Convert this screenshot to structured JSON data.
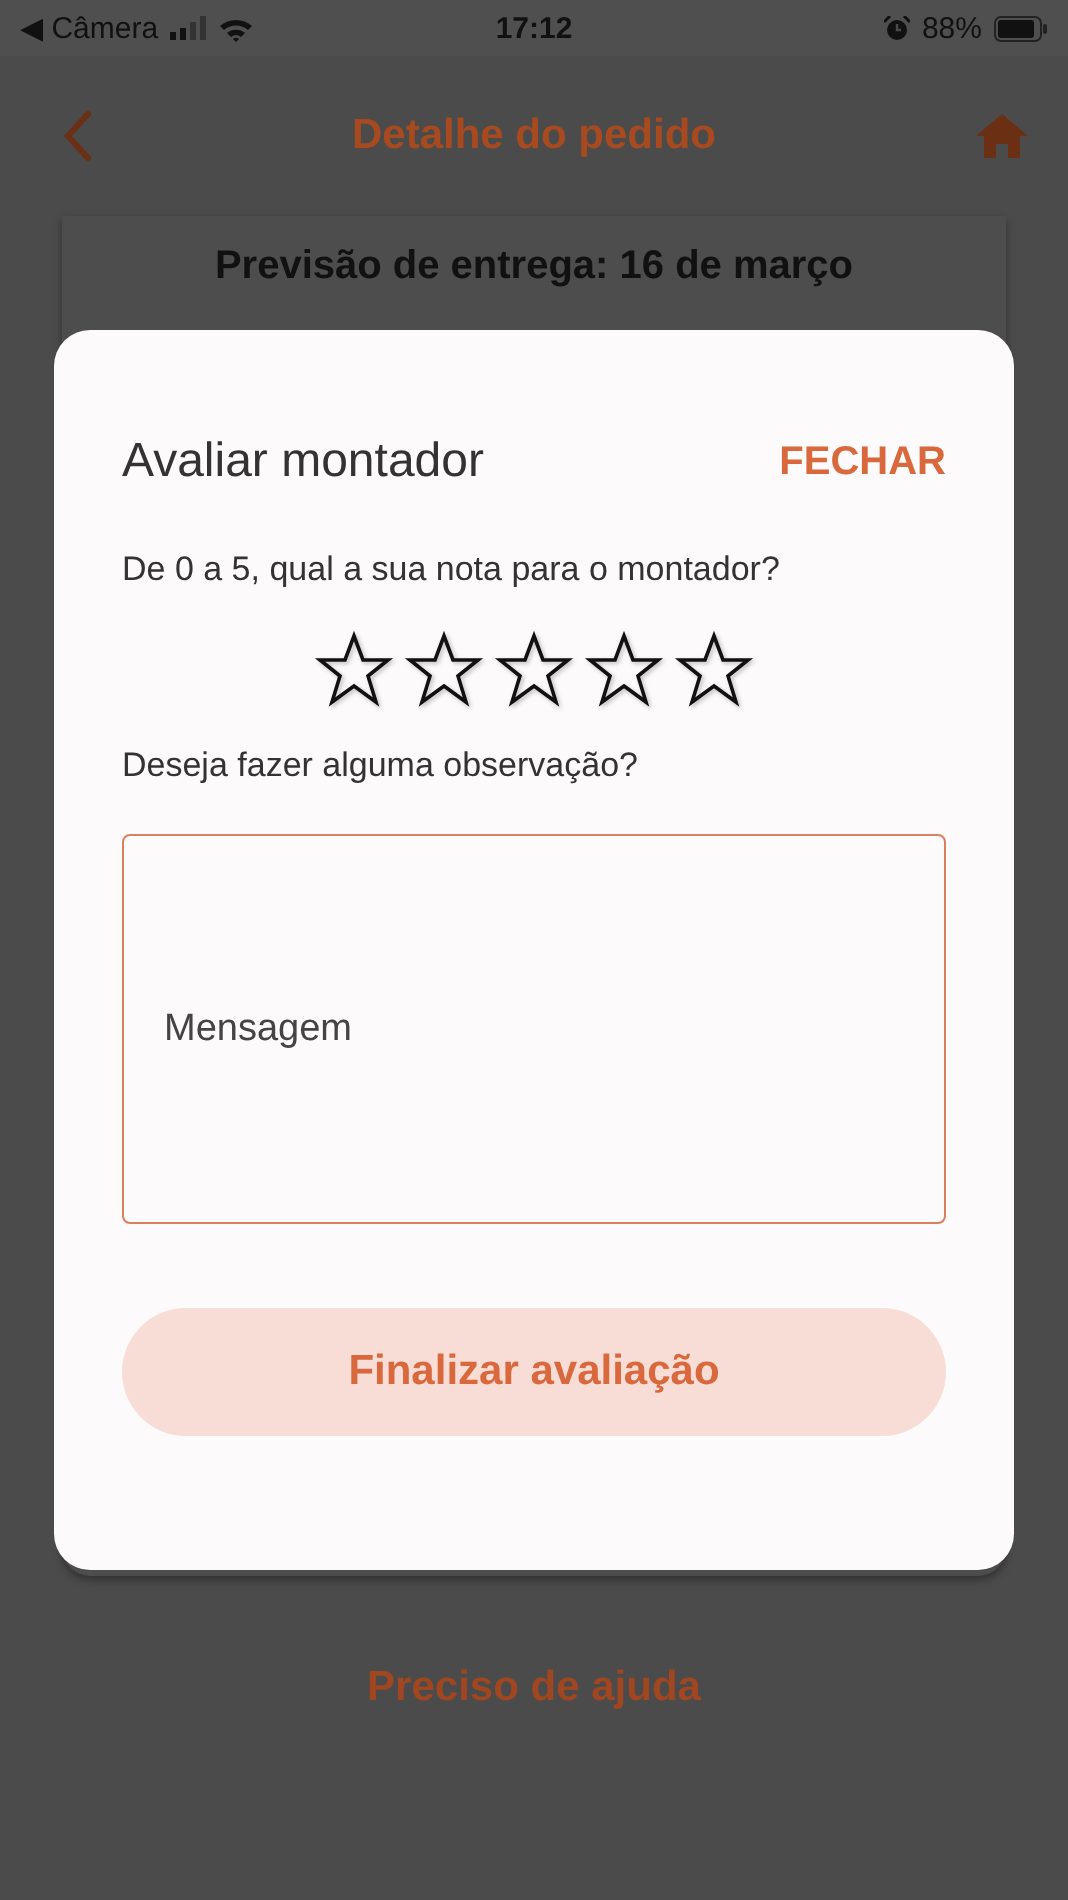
{
  "status_bar": {
    "back_label": "◀ Câmera",
    "time": "17:12",
    "battery": "88%"
  },
  "header": {
    "title": "Detalhe do pedido"
  },
  "delivery_card": {
    "text": "Previsão de entrega: 16 de março"
  },
  "help_link": "Preciso de ajuda",
  "dialog": {
    "title": "Avaliar montador",
    "close": "FECHAR",
    "question": "De 0 a 5, qual a sua nota para o montador?",
    "stars": 0,
    "comment_question": "Deseja fazer alguma observação?",
    "message": {
      "placeholder": "Mensagem"
    },
    "submit": "Finalizar avaliação"
  }
}
